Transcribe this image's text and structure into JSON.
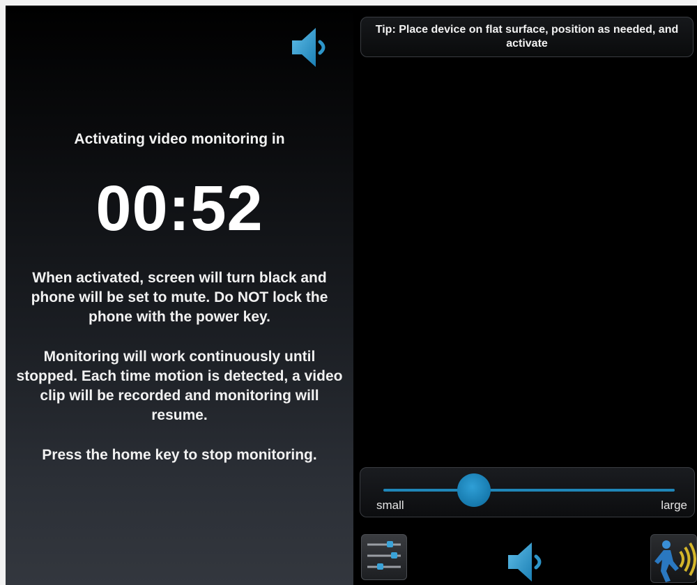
{
  "left": {
    "heading": "Activating video monitoring in",
    "timer": "00:52",
    "info1": "When activated, screen will turn black and phone will be set to mute. Do NOT lock the phone with the power key.",
    "info2": "Monitoring will work continuously until stopped. Each time motion is detected, a video clip will be recorded and monitoring will resume.",
    "info3": "Press the home key to stop monitoring."
  },
  "right": {
    "tip": "Tip: Place device on flat surface, position as needed, and activate",
    "slider": {
      "min_label": "small",
      "max_label": "large",
      "value_fraction": 0.31
    }
  },
  "icons": {
    "top_speaker": "speaker-icon",
    "bottom_speaker": "speaker-icon",
    "settings": "sliders-icon",
    "motion": "motion-detect-icon"
  },
  "colors": {
    "accent": "#1f86b8",
    "motion": "#d4b62a"
  }
}
